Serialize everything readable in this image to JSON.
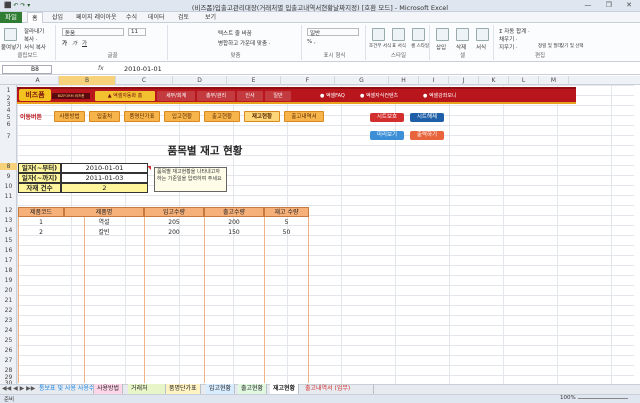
{
  "window": {
    "title": "(비즈폼)입출고관리대장(거래처별 입출고내역서현황날짜지정) [호환 모드] - Microsoft Excel",
    "quick_access": "⬛ ↶ ↷ ▾",
    "controls": "— ❐ ✕"
  },
  "menu": {
    "file": "파일",
    "tabs": [
      "홈",
      "삽입",
      "페이지 레이아웃",
      "수식",
      "데이터",
      "검토",
      "보기"
    ]
  },
  "ribbon": {
    "clipboard": {
      "label": "클립보드",
      "paste": "붙여넣기",
      "cut": "잘라내기",
      "copy": "복사 ·",
      "format_painter": "서식 복사"
    },
    "font": {
      "label": "글꼴",
      "name": "돋움",
      "size": "11",
      "bold": "가",
      "italic": "가",
      "underline": "가"
    },
    "alignment": {
      "label": "맞춤",
      "wrap": "텍스트 줄 바꿈",
      "merge": "병합하고 가운데 맞춤 ·"
    },
    "number": {
      "label": "표시 형식",
      "format": "일반",
      "pct": "% ,"
    },
    "styles": {
      "label": "스타일",
      "cond": "조건부 서식",
      "table": "표 서식",
      "cell": "셀 스타일"
    },
    "cells": {
      "label": "셀",
      "insert": "삽입",
      "delete": "삭제",
      "format": "서식"
    },
    "editing": {
      "label": "편집",
      "autosum": "Σ 자동 합계 ·",
      "fill": "채우기 ·",
      "clear": "지우기 ·",
      "sort": "정렬 및 필터",
      "find": "찾기 및 선택"
    }
  },
  "formula_bar": {
    "name_box": "B8",
    "fx": "fx",
    "value": "2010-01-01"
  },
  "columns": [
    "A",
    "B",
    "C",
    "D",
    "E",
    "F",
    "G",
    "H",
    "I",
    "J",
    "K",
    "L",
    "M"
  ],
  "rows": [
    "1",
    "2",
    "3",
    "4",
    "5",
    "6",
    "7",
    "8",
    "9",
    "10",
    "11",
    "12",
    "13",
    "14",
    "15",
    "16",
    "17",
    "18",
    "19",
    "20",
    "21",
    "22",
    "23",
    "24",
    "25",
    "26",
    "27",
    "28",
    "29",
    "30"
  ],
  "banner": {
    "logo": "비즈폼",
    "logo_sub": "BIZFORM 비즈폼",
    "tabs": [
      "▲ 엑셀자동화 홈",
      "세무/회계",
      "총무/관리",
      "인사",
      "일반"
    ],
    "links": [
      "● 엑셀FAQ",
      "● 엑셀자식컨텐츠",
      "● 엑셀강좌모니"
    ]
  },
  "nav": {
    "label": "이동버튼",
    "buttons": [
      "사용방법",
      "입출처",
      "품명단가표",
      "입고현황",
      "출고현황",
      "재고현황",
      "출고내역서"
    ]
  },
  "side_buttons": {
    "protect": "시트보호",
    "unprotect": "시트해제",
    "preview": "미리보기",
    "print": "출력하기"
  },
  "report": {
    "title": "품목별 재고 현황",
    "from_label": "일자(~부터)",
    "from_value": "2010-01-01",
    "to_label": "일자(~까지)",
    "to_value": "2011-01-03",
    "count_label": "자재 건수",
    "count_value": "2",
    "note": "품목별 재고현황을 나타내고자하는 기준일을 입력하여 주세요",
    "headers": [
      "제품코드",
      "제품명",
      "입고수량",
      "출고수량",
      "재고 수량"
    ],
    "rows": [
      [
        "1",
        "역설",
        "205",
        "200",
        "5"
      ],
      [
        "2",
        "칼빈",
        "200",
        "150",
        "50"
      ]
    ]
  },
  "sheet_tabs": [
    "통보표 및 사용 사용수",
    "사용방법",
    "거래처",
    "품명단가표",
    "입고현황",
    "출고현황",
    "재고현황",
    "출고내역서 (업무)"
  ],
  "status": {
    "ready": "준비",
    "zoom": "100%"
  },
  "colors": {
    "banner": "#b8151c",
    "accent": "#f4c21f",
    "nav": "#f7b44b",
    "table_header": "#f6b07a",
    "input_fill": "#fff59c",
    "excel_green": "#2e7d32"
  }
}
